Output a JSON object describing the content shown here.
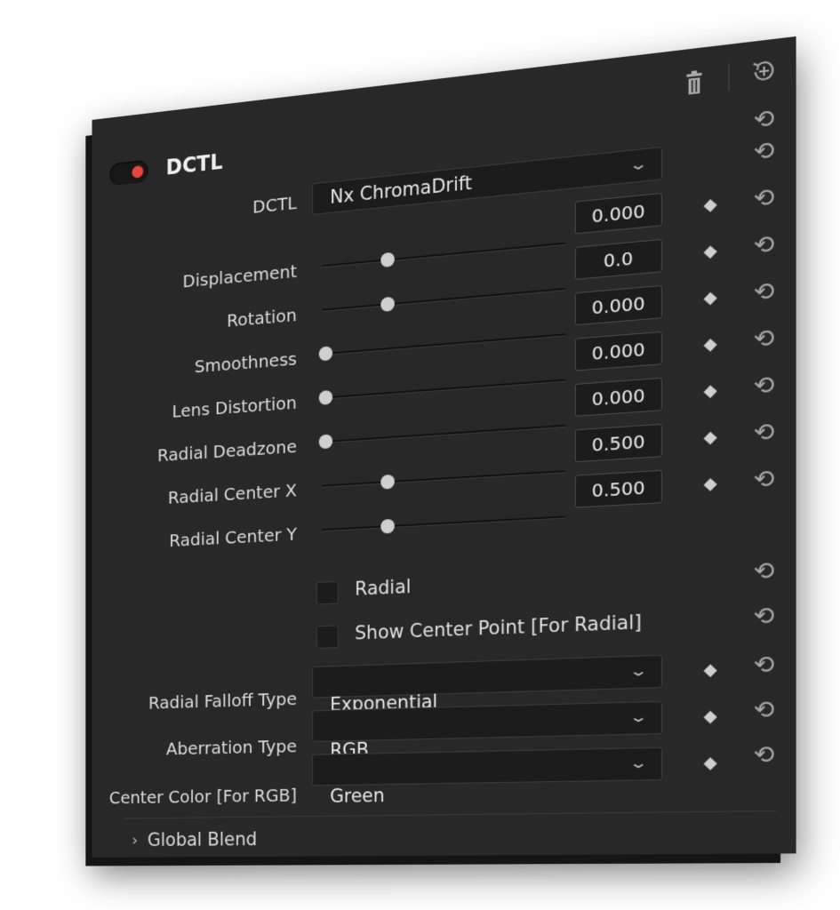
{
  "header": {
    "title": "DCTL",
    "enabled": true,
    "delete_icon": "trash-icon",
    "reset_all_icon": "reset-all-icon"
  },
  "dctl_select": {
    "label": "DCTL",
    "value": "Nx ChromaDrift"
  },
  "params": [
    {
      "label": "Displacement",
      "value": "0.000",
      "slider_fraction": 0.5
    },
    {
      "label": "Rotation",
      "value": "0.0",
      "slider_fraction": 0.5
    },
    {
      "label": "Smoothness",
      "value": "0.000",
      "slider_fraction": 0.0
    },
    {
      "label": "Lens Distortion",
      "value": "0.000",
      "slider_fraction": 0.0
    },
    {
      "label": "Radial Deadzone",
      "value": "0.000",
      "slider_fraction": 0.0
    },
    {
      "label": "Radial Center X",
      "value": "0.500",
      "slider_fraction": 0.5
    },
    {
      "label": "Radial Center Y",
      "value": "0.500",
      "slider_fraction": 0.5
    }
  ],
  "checkboxes": [
    {
      "label": "Radial",
      "checked": false
    },
    {
      "label": "Show Center Point [For Radial]",
      "checked": false
    }
  ],
  "dropdowns": [
    {
      "label": "Radial Falloff Type",
      "value": "Exponential"
    },
    {
      "label": "Aberration Type",
      "value": "RGB"
    },
    {
      "label": "Center Color [For RGB]",
      "value": "Green"
    }
  ],
  "footer": {
    "global_blend": "Global Blend"
  },
  "colors": {
    "panel_bg": "#282828",
    "toggle_on": "#e7463a"
  }
}
